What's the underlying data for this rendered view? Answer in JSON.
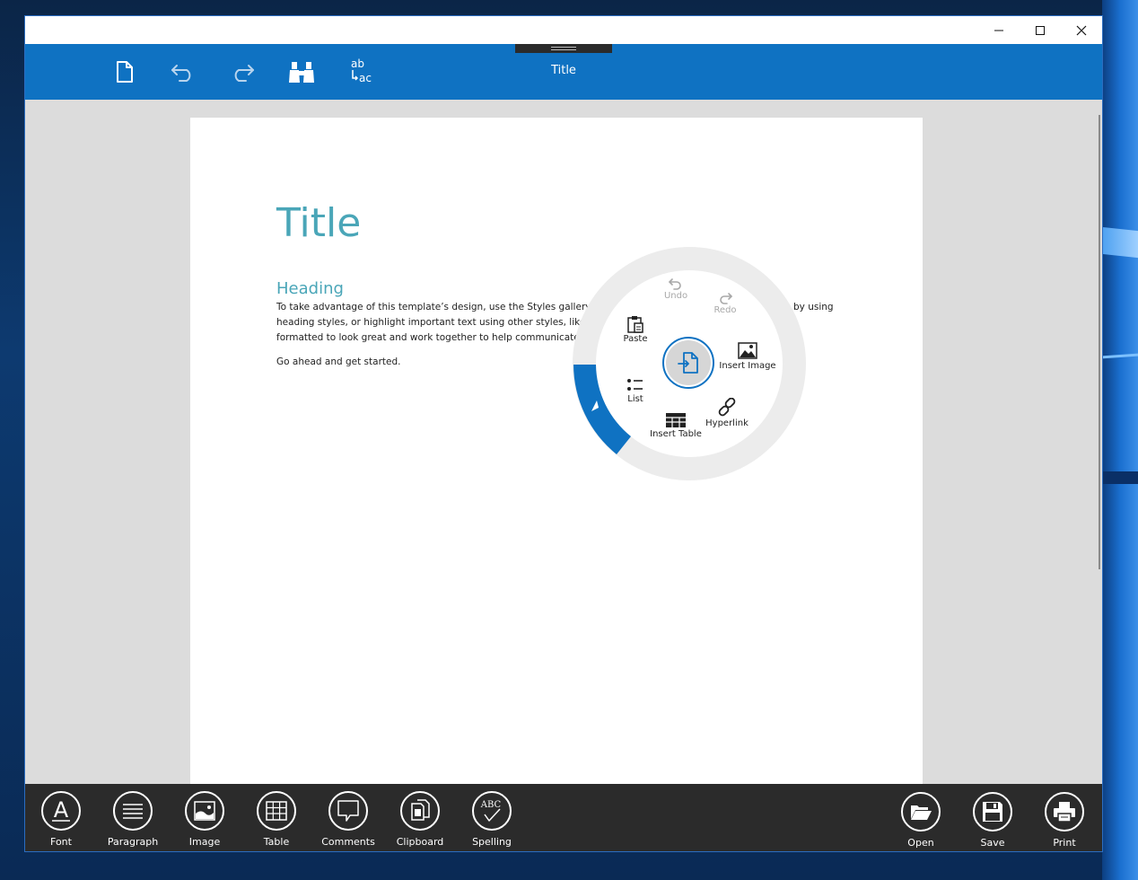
{
  "window": {
    "caption_buttons": {
      "minimize": "minimize-icon",
      "maximize": "maximize-icon",
      "close": "close-icon"
    }
  },
  "ribbon": {
    "title": "Title",
    "icons": [
      "new-document-icon",
      "undo-icon",
      "redo-icon",
      "find-binoculars-icon",
      "replace-icon"
    ],
    "replace_icon_text": {
      "top": "ab",
      "bottom": "ac"
    },
    "accent_color": "#0f72c2"
  },
  "document": {
    "title": "Title",
    "heading": "Heading",
    "paragraph_lines": [
      " To take advantage of this template’s design, use the Styles gallery on",
      "heading styles, or highlight important text using other styles, like Em",
      "formatted to look great and work together to help communicate yo"
    ],
    "paragraph_tail": "by using",
    "paragraph2": "Go ahead and get started.",
    "title_color": "#4aa6b8"
  },
  "radial_menu": {
    "center_icon": "insert-file-icon",
    "items": {
      "undo": "Undo",
      "redo": "Redo",
      "paste": "Paste",
      "insert_image": "Insert Image",
      "list": "List",
      "hyperlink": "Hyperlink",
      "insert_table": "Insert Table"
    },
    "accent_color": "#0f72c2"
  },
  "bottom_bar": {
    "left": [
      {
        "label": "Font",
        "icon": "font-icon"
      },
      {
        "label": "Paragraph",
        "icon": "paragraph-icon"
      },
      {
        "label": "Image",
        "icon": "image-icon"
      },
      {
        "label": "Table",
        "icon": "table-icon"
      },
      {
        "label": "Comments",
        "icon": "comments-icon"
      },
      {
        "label": "Clipboard",
        "icon": "clipboard-icon"
      },
      {
        "label": "Spelling",
        "icon": "spelling-icon"
      }
    ],
    "right": [
      {
        "label": "Open",
        "icon": "open-folder-icon"
      },
      {
        "label": "Save",
        "icon": "save-icon"
      },
      {
        "label": "Print",
        "icon": "print-icon"
      }
    ],
    "font_glyph": "A",
    "spelling_glyph": "ABC"
  }
}
